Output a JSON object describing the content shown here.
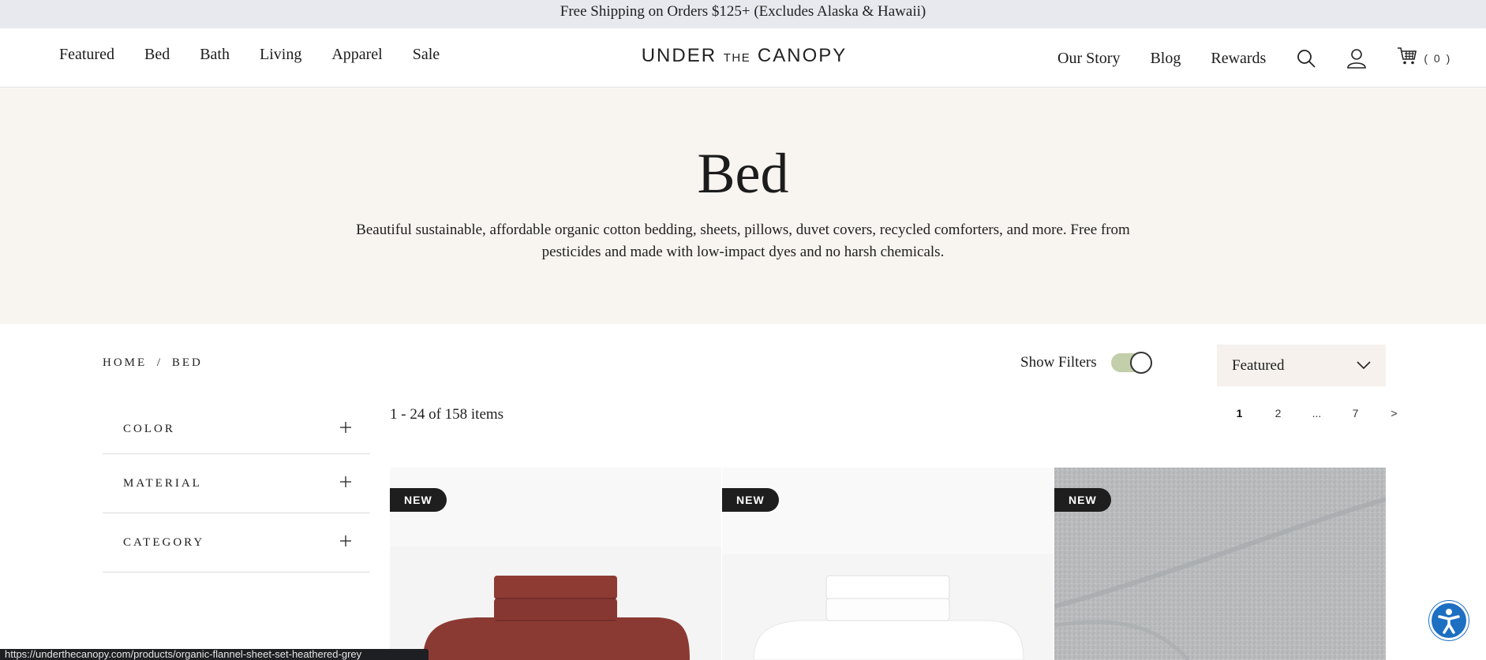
{
  "promo": {
    "text": "Free Shipping on Orders $125+ (Excludes Alaska & Hawaii)"
  },
  "header": {
    "nav_left": [
      "Featured",
      "Bed",
      "Bath",
      "Living",
      "Apparel",
      "Sale"
    ],
    "logo": {
      "part1": "UNDER",
      "part2": "THE",
      "part3": "CANOPY"
    },
    "nav_right": [
      "Our Story",
      "Blog",
      "Rewards"
    ],
    "cart_count": "( 0 )"
  },
  "hero": {
    "title": "Bed",
    "description": "Beautiful sustainable, affordable organic cotton bedding, sheets, pillows, duvet covers, recycled comforters, and more. Free from pesticides and made with low-impact dyes and no harsh chemicals."
  },
  "breadcrumb": {
    "home": "HOME",
    "separator": "/",
    "current": "BED"
  },
  "filters": {
    "label": "Show Filters",
    "enabled": true
  },
  "sort": {
    "selected": "Featured"
  },
  "facets": [
    "COLOR",
    "MATERIAL",
    "CATEGORY"
  ],
  "results": {
    "count_text": "1 - 24 of 158 items"
  },
  "pagination": {
    "items": [
      "1",
      "2",
      "...",
      "7",
      ">"
    ],
    "current": "1"
  },
  "products": [
    {
      "badge": "NEW",
      "color": "#8b3a33"
    },
    {
      "badge": "NEW",
      "color": "#ffffff"
    },
    {
      "badge": "NEW",
      "color": "#b9bbbd"
    }
  ],
  "status_bar": {
    "url": "https://underthecanopy.com/products/organic-flannel-sheet-set-heathered-grey"
  },
  "colors": {
    "promo_bg": "#e8e9ef",
    "hero_bg": "#f8f4f0",
    "toggle_on": "#c3ceaa",
    "accessibility_blue": "#1d6fc2"
  }
}
